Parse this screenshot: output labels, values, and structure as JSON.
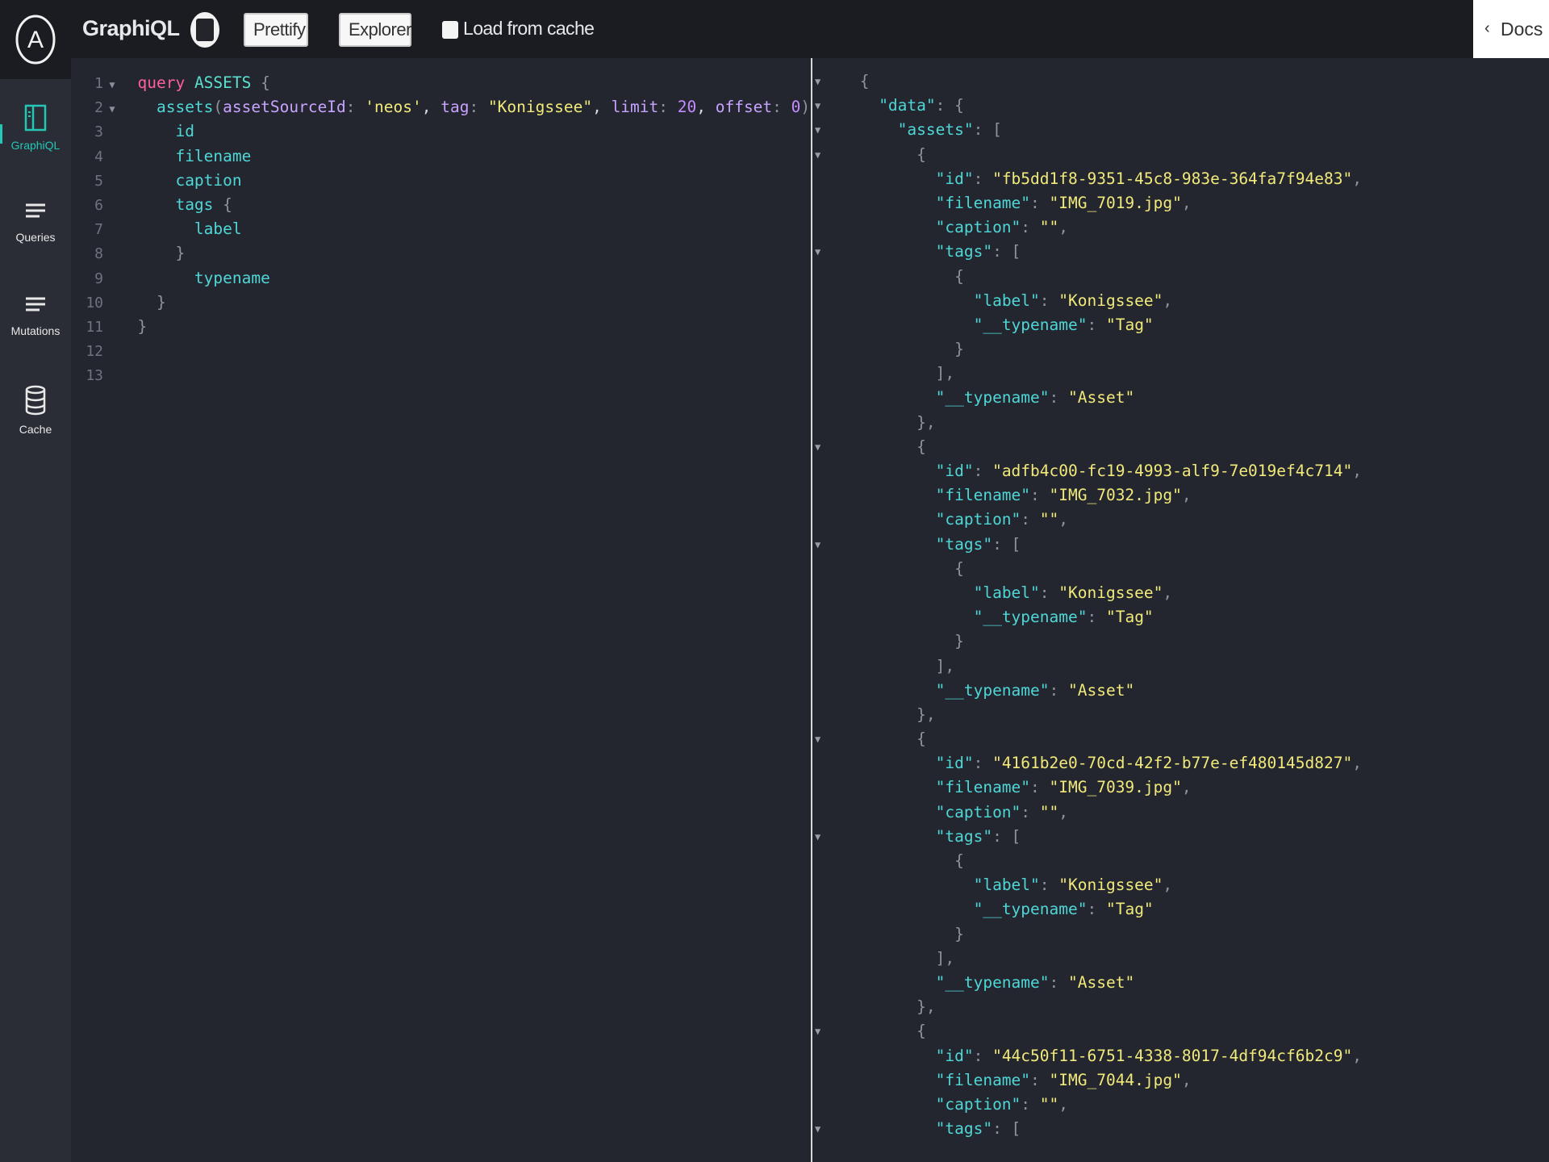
{
  "toolbar": {
    "title": "GraphiQL",
    "prettify_label": "Prettify",
    "explorer_label": "Explorer",
    "load_from_cache_label": "Load from cache",
    "load_from_cache_checked": false,
    "docs_label": "Docs"
  },
  "sidebar": {
    "logo_letter": "A",
    "items": [
      {
        "label": "GraphiQL",
        "icon": "graphiql-icon",
        "active": true
      },
      {
        "label": "Queries",
        "icon": "list-icon",
        "active": false
      },
      {
        "label": "Mutations",
        "icon": "list-icon",
        "active": false
      },
      {
        "label": "Cache",
        "icon": "database-icon",
        "active": false
      }
    ]
  },
  "editor": {
    "line_numbers": [
      "1",
      "2",
      "3",
      "4",
      "5",
      "6",
      "7",
      "8",
      "9",
      "10",
      "11",
      "12",
      "13"
    ],
    "query_keyword": "query",
    "operation_name": "ASSETS",
    "field_assets": "assets",
    "arg_assetSourceId": "assetSourceId",
    "val_assetSourceId": "'neos'",
    "arg_tag": "tag",
    "val_tag": "\"Konigssee\"",
    "arg_limit": "limit",
    "val_limit": "20",
    "arg_offset": "offset",
    "val_offset": "0",
    "field_id": "id",
    "field_filename": "filename",
    "field_caption": "caption",
    "field_tags": "tags",
    "field_label": "label",
    "field_typename": "typename"
  },
  "result": {
    "key_data": "\"data\"",
    "key_assets": "\"assets\"",
    "assets": [
      {
        "id": "\"fb5dd1f8-9351-45c8-983e-364fa7f94e83\"",
        "filename": "\"IMG_7019.jpg\"",
        "caption": "\"\"",
        "tag_label": "\"Konigssee\"",
        "tag_typename": "\"Tag\"",
        "typename": "\"Asset\""
      },
      {
        "id": "\"adfb4c00-fc19-4993-alf9-7e019ef4c714\"",
        "filename": "\"IMG_7032.jpg\"",
        "caption": "\"\"",
        "tag_label": "\"Konigssee\"",
        "tag_typename": "\"Tag\"",
        "typename": "\"Asset\""
      },
      {
        "id": "\"4161b2e0-70cd-42f2-b77e-ef480145d827\"",
        "filename": "\"IMG_7039.jpg\"",
        "caption": "\"\"",
        "tag_label": "\"Konigssee\"",
        "tag_typename": "\"Tag\"",
        "typename": "\"Asset\""
      },
      {
        "id": "\"44c50f11-6751-4338-8017-4df94cf6b2c9\"",
        "filename": "\"IMG_7044.jpg\"",
        "caption": "\"\"",
        "tag_label": "",
        "tag_typename": "",
        "typename": ""
      }
    ],
    "key_id": "\"id\"",
    "key_filename": "\"filename\"",
    "key_caption": "\"caption\"",
    "key_tags": "\"tags\"",
    "key_label": "\"label\"",
    "key_typename": "\"__typename\""
  },
  "colors": {
    "background": "#1f2128",
    "accent": "#24c6b6",
    "keyword": "#ff5f9e",
    "string": "#f1e97a"
  }
}
